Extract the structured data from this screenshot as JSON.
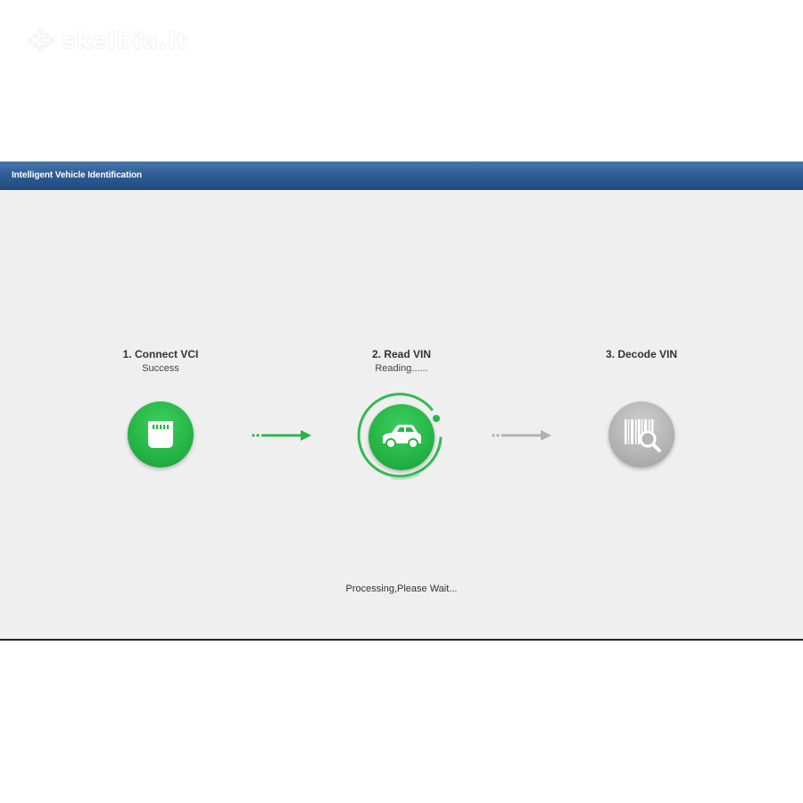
{
  "watermark": {
    "text": "skelbiu.lt"
  },
  "window": {
    "title": "Intelligent Vehicle Identification"
  },
  "steps": [
    {
      "title": "1. Connect VCI",
      "status": "Success",
      "icon": "vci-connector-icon",
      "state": "done"
    },
    {
      "title": "2. Read VIN",
      "status": "Reading......",
      "icon": "car-icon",
      "state": "active"
    },
    {
      "title": "3. Decode VIN",
      "status": "",
      "icon": "barcode-search-icon",
      "state": "pending"
    }
  ],
  "footer": {
    "message": "Processing,Please Wait..."
  },
  "colors": {
    "accent": "#26b747",
    "inactive": "#b0b0b0",
    "titlebar": "#2f5d94",
    "background": "#efefef"
  }
}
